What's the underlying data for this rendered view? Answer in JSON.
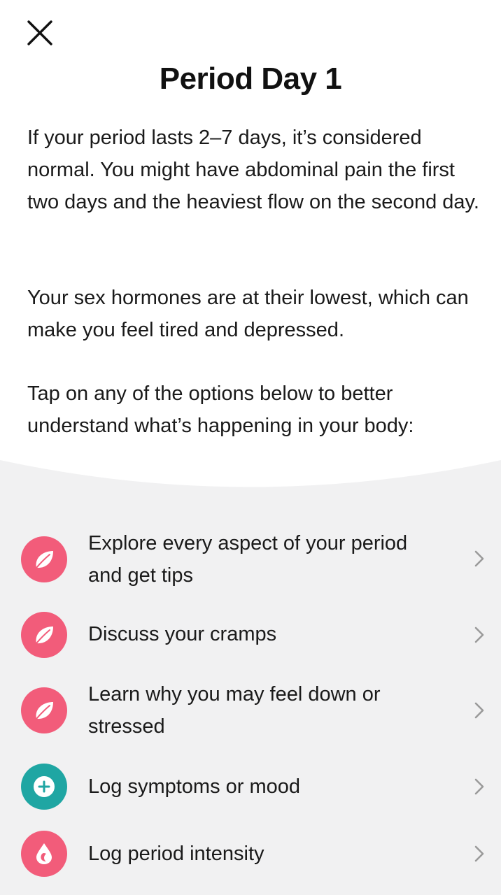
{
  "header": {
    "close_icon": "close-icon",
    "title": "Period Day 1"
  },
  "content": {
    "paragraph_1": "If your period lasts 2–7 days, it’s considered normal. You might have abdominal pain the first two days and the heaviest flow on the second day.",
    "paragraph_2": "Your sex hormones are at their lowest, which can make you feel tired and depressed.",
    "paragraph_3": "Tap on any of the options below to better understand what’s happening in your body:"
  },
  "options": [
    {
      "label": "Explore every aspect of your period and get tips",
      "icon": "leaf-icon",
      "color": "#f25c7a"
    },
    {
      "label": "Discuss your cramps",
      "icon": "leaf-icon",
      "color": "#f25c7a"
    },
    {
      "label": "Learn why you may feel down or stressed",
      "icon": "leaf-icon",
      "color": "#f25c7a"
    },
    {
      "label": "Log symptoms or mood",
      "icon": "plus-icon",
      "color": "#1fa6a3"
    },
    {
      "label": "Log period intensity",
      "icon": "drop-icon",
      "color": "#f25c7a"
    }
  ],
  "colors": {
    "accent_pink": "#f25c7a",
    "accent_teal": "#1fa6a3",
    "panel_background": "#f1f1f2",
    "chevron": "#9a9a9a"
  }
}
